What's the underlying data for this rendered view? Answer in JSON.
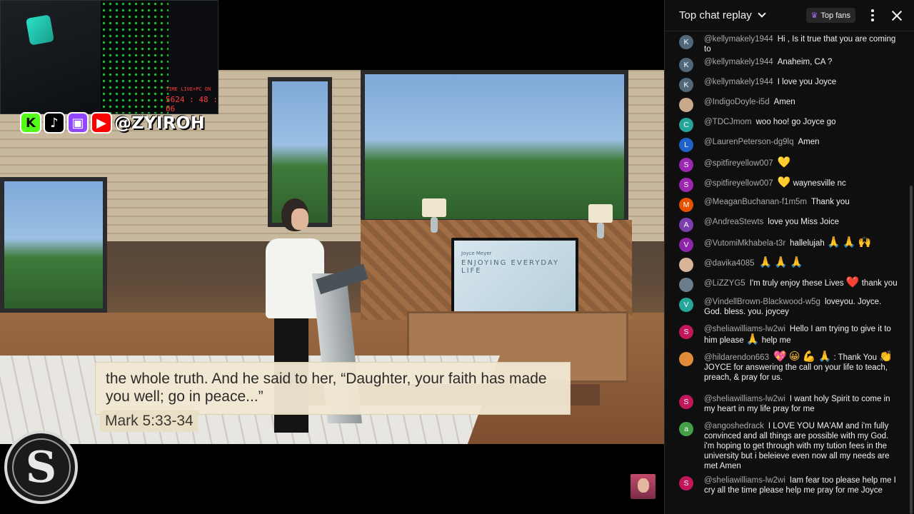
{
  "video": {
    "tv_small": "Joyce Meyer",
    "tv_title": "ENJOYING EVERYDAY LIFE",
    "caption": "the whole truth. And he said to her, “Daughter, your faith has made you well; go in peace...”",
    "caption_reference": "Mark 5:33-34"
  },
  "overlay": {
    "cam_timer_label": "TIME LIVE+PC ON",
    "cam_timer": "5624 : 48 : 06",
    "social_handle": "@ZYIROH",
    "social_icons": [
      "kick-icon",
      "tiktok-icon",
      "twitch-icon",
      "youtube-icon",
      "instagram-icon"
    ],
    "brand_letter": "S"
  },
  "chat": {
    "title": "Top chat replay",
    "top_fans_label": "Top fans",
    "messages": [
      {
        "initial": "K",
        "color": "#51687a",
        "author": "@kellymakely1944",
        "text": "Hi , Is it true that you are coming to"
      },
      {
        "initial": "K",
        "color": "#51687a",
        "author": "@kellymakely1944",
        "text": "Anaheim, CA ?"
      },
      {
        "initial": "K",
        "color": "#51687a",
        "author": "@kellymakely1944",
        "text": "I love you Joyce"
      },
      {
        "initial": "",
        "color": "#c9a98c",
        "author": "@IndigoDoyle-i5d",
        "text": "Amen"
      },
      {
        "initial": "C",
        "color": "#26a69a",
        "author": "@TDCJmom",
        "text": "woo hoo! go Joyce go"
      },
      {
        "initial": "L",
        "color": "#1e63c9",
        "author": "@LaurenPeterson-dg9lq",
        "text": "Amen"
      },
      {
        "initial": "S",
        "color": "#9c27b0",
        "author": "@spitfireyellow007",
        "text": "💛"
      },
      {
        "initial": "S",
        "color": "#9c27b0",
        "author": "@spitfireyellow007",
        "text": "💛 waynesville nc"
      },
      {
        "initial": "M",
        "color": "#e65100",
        "author": "@MeaganBuchanan-f1m5m",
        "text": "Thank you"
      },
      {
        "initial": "A",
        "color": "#7b3fb0",
        "author": "@AndreaStewts",
        "text": "love you Miss Joice"
      },
      {
        "initial": "V",
        "color": "#8e24aa",
        "author": "@VutomiMkhabela-t3r",
        "text": "hallelujah 🙏 🙏 🙌"
      },
      {
        "initial": "",
        "color": "#d8b49a",
        "author": "@davika4085",
        "text": "🙏 🙏 🙏"
      },
      {
        "initial": "",
        "color": "#6b7d8a",
        "author": "@LiZZYG5",
        "text": "I'm truly enjoy these Lives ❤️ thank you"
      },
      {
        "initial": "V",
        "color": "#26a69a",
        "author": "@VindellBrown-Blackwood-w5g",
        "text": "loveyou. Joyce. God. bless. you. joycey"
      },
      {
        "initial": "S",
        "color": "#c2185b",
        "author": "@sheliawilliams-lw2wi",
        "text": "Hello I am trying to give it to him please 🙏 help me"
      },
      {
        "initial": "",
        "color": "#e08a3a",
        "author": "@hildarendon663",
        "text": "💖 😀 💪 🙏 : Thank You 👏 JOYCE for answering the call on your life to teach, preach, & pray for us."
      },
      {
        "initial": "S",
        "color": "#c2185b",
        "author": "@sheliawilliams-lw2wi",
        "text": "I want holy Spirit to come in my heart in my life pray for me"
      },
      {
        "initial": "a",
        "color": "#43a047",
        "author": "@angoshedrack",
        "text": "I LOVE YOU MA'AM and i'm fully convinced and all things are possible with my God. i'm hoping to get through with my tution fees in the university but i beleieve even now all my needs are met Amen"
      },
      {
        "initial": "S",
        "color": "#c2185b",
        "author": "@sheliawilliams-lw2wi",
        "text": "Iam fear too please help me I cry all the time please help me pray for me Joyce"
      }
    ]
  }
}
